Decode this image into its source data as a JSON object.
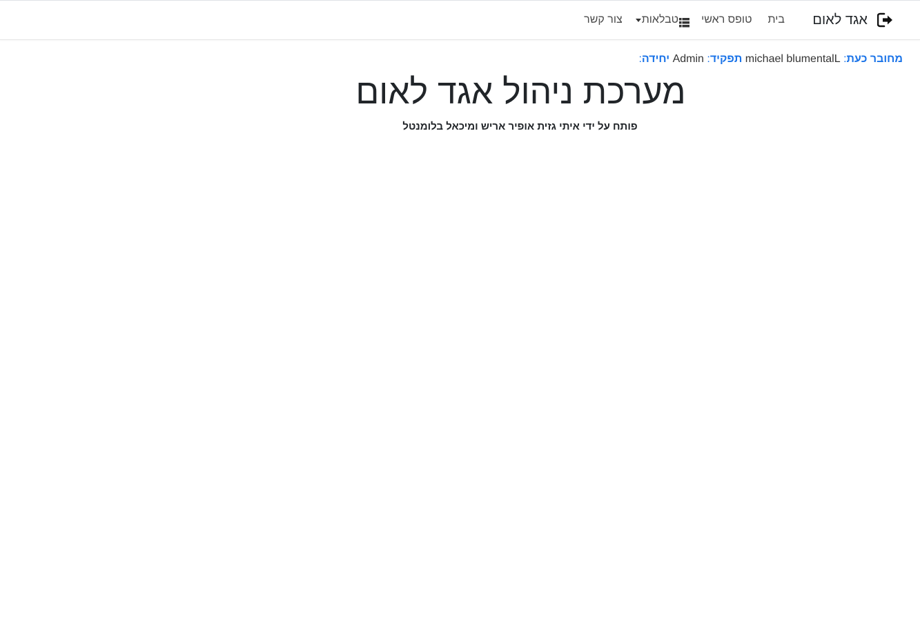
{
  "navbar": {
    "brand_label": "אגד לאום",
    "brand_icon": "sign-out-icon",
    "items": [
      {
        "label": "בית"
      },
      {
        "label": "טופס ראשי"
      },
      {
        "label": "טבלאות",
        "icon": "list-icon",
        "has_dropdown": true
      },
      {
        "label": "צור קשר"
      }
    ]
  },
  "user_info": {
    "logged_in_label": "מחובר כעת",
    "username": "michael blumentalL",
    "role_label": "תפקיד",
    "role_value": "Admin",
    "unit_label": "יחידה",
    "unit_value": ""
  },
  "main": {
    "title": "מערכת ניהול אגד לאום",
    "subtitle": "פותח על ידי איתי גזית אופיר אריש ומיכאל בלומנטל"
  },
  "colors": {
    "accent_blue": "#1a73e8",
    "text_dark": "#212529",
    "nav_text": "#4a4a4a",
    "background": "#ffffff"
  }
}
